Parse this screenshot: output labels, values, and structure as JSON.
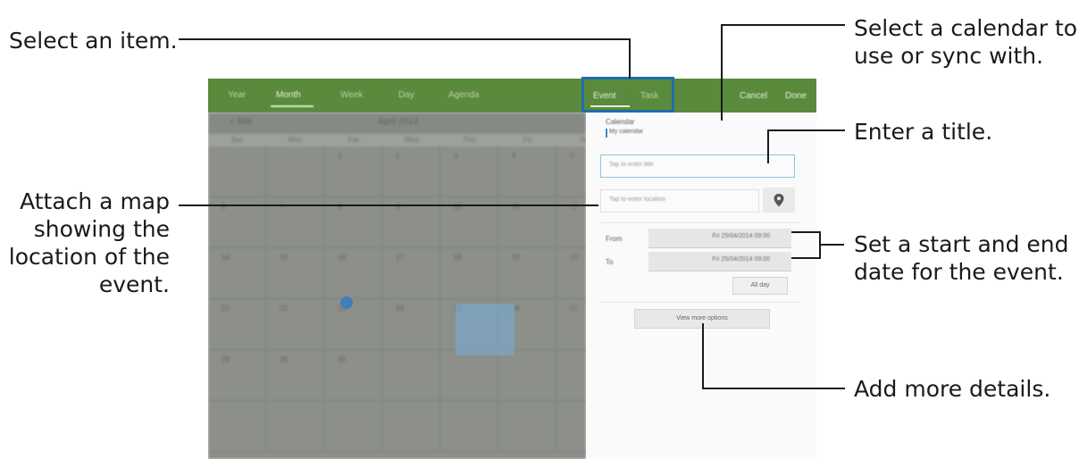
{
  "callouts": {
    "select_item": "Select an item.",
    "attach_map": [
      "Attach a map",
      "showing the",
      "location of the",
      "event."
    ],
    "select_calendar": [
      "Select a calendar to",
      "use or sync with."
    ],
    "enter_title": "Enter a title.",
    "set_dates": [
      "Set a start and end",
      "date for the event."
    ],
    "add_details": "Add more details."
  },
  "topbar": {
    "view_tabs": [
      "Year",
      "Month",
      "Week",
      "Day",
      "Agenda"
    ],
    "active_view": "Month",
    "type_tabs": {
      "event": "Event",
      "task": "Task"
    },
    "cancel": "Cancel",
    "done": "Done",
    "color": "#5a8a3c"
  },
  "calendar": {
    "month_title": "April 2014",
    "prev": "< Mar",
    "weekdays": [
      "Sun",
      "Mon",
      "Tue",
      "Wed",
      "Thu",
      "Fri",
      "Sat"
    ],
    "weeks": [
      [
        "",
        "",
        "1",
        "2",
        "3",
        "4",
        "5"
      ],
      [
        "6",
        "7",
        "8",
        "9",
        "10",
        "11",
        "12"
      ],
      [
        "14",
        "15",
        "16",
        "17",
        "18",
        "19",
        "20"
      ],
      [
        "21",
        "22",
        "23",
        "24",
        "25",
        "26",
        "27"
      ],
      [
        "28",
        "29",
        "30",
        "",
        "",
        "",
        ""
      ],
      [
        "",
        "",
        "",
        "",
        "",
        "",
        ""
      ]
    ]
  },
  "panel": {
    "calendar_label": "Calendar",
    "calendar_value": "My calendar",
    "title_placeholder": "Tap to enter title",
    "location_placeholder": "Tap to enter location",
    "from_label": "From",
    "to_label": "To",
    "from_value": "Fri 25/04/2014 09:00",
    "to_value": "Fri 25/04/2014 09:00",
    "all_day": "All day",
    "more_options": "View more options"
  }
}
